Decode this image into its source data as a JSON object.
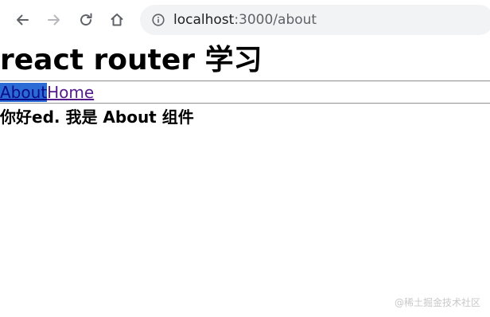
{
  "browser": {
    "url_host": "localhost",
    "url_path": ":3000/about",
    "icons": {
      "back": "back-arrow-icon",
      "forward": "forward-arrow-icon",
      "reload": "reload-icon",
      "home": "home-icon",
      "info": "info-icon"
    },
    "forward_disabled": true
  },
  "page": {
    "title": "react router 学习",
    "nav": {
      "about_label": "About",
      "home_label": "Home",
      "about_selected": true
    },
    "content_heading": "你好ed. 我是 About 组件"
  },
  "watermark": "@稀土掘金技术社区",
  "colors": {
    "link_visited": "#551a8b",
    "selection_highlight": "#2b6bd6",
    "omnibox_bg": "#f1f3f4"
  }
}
